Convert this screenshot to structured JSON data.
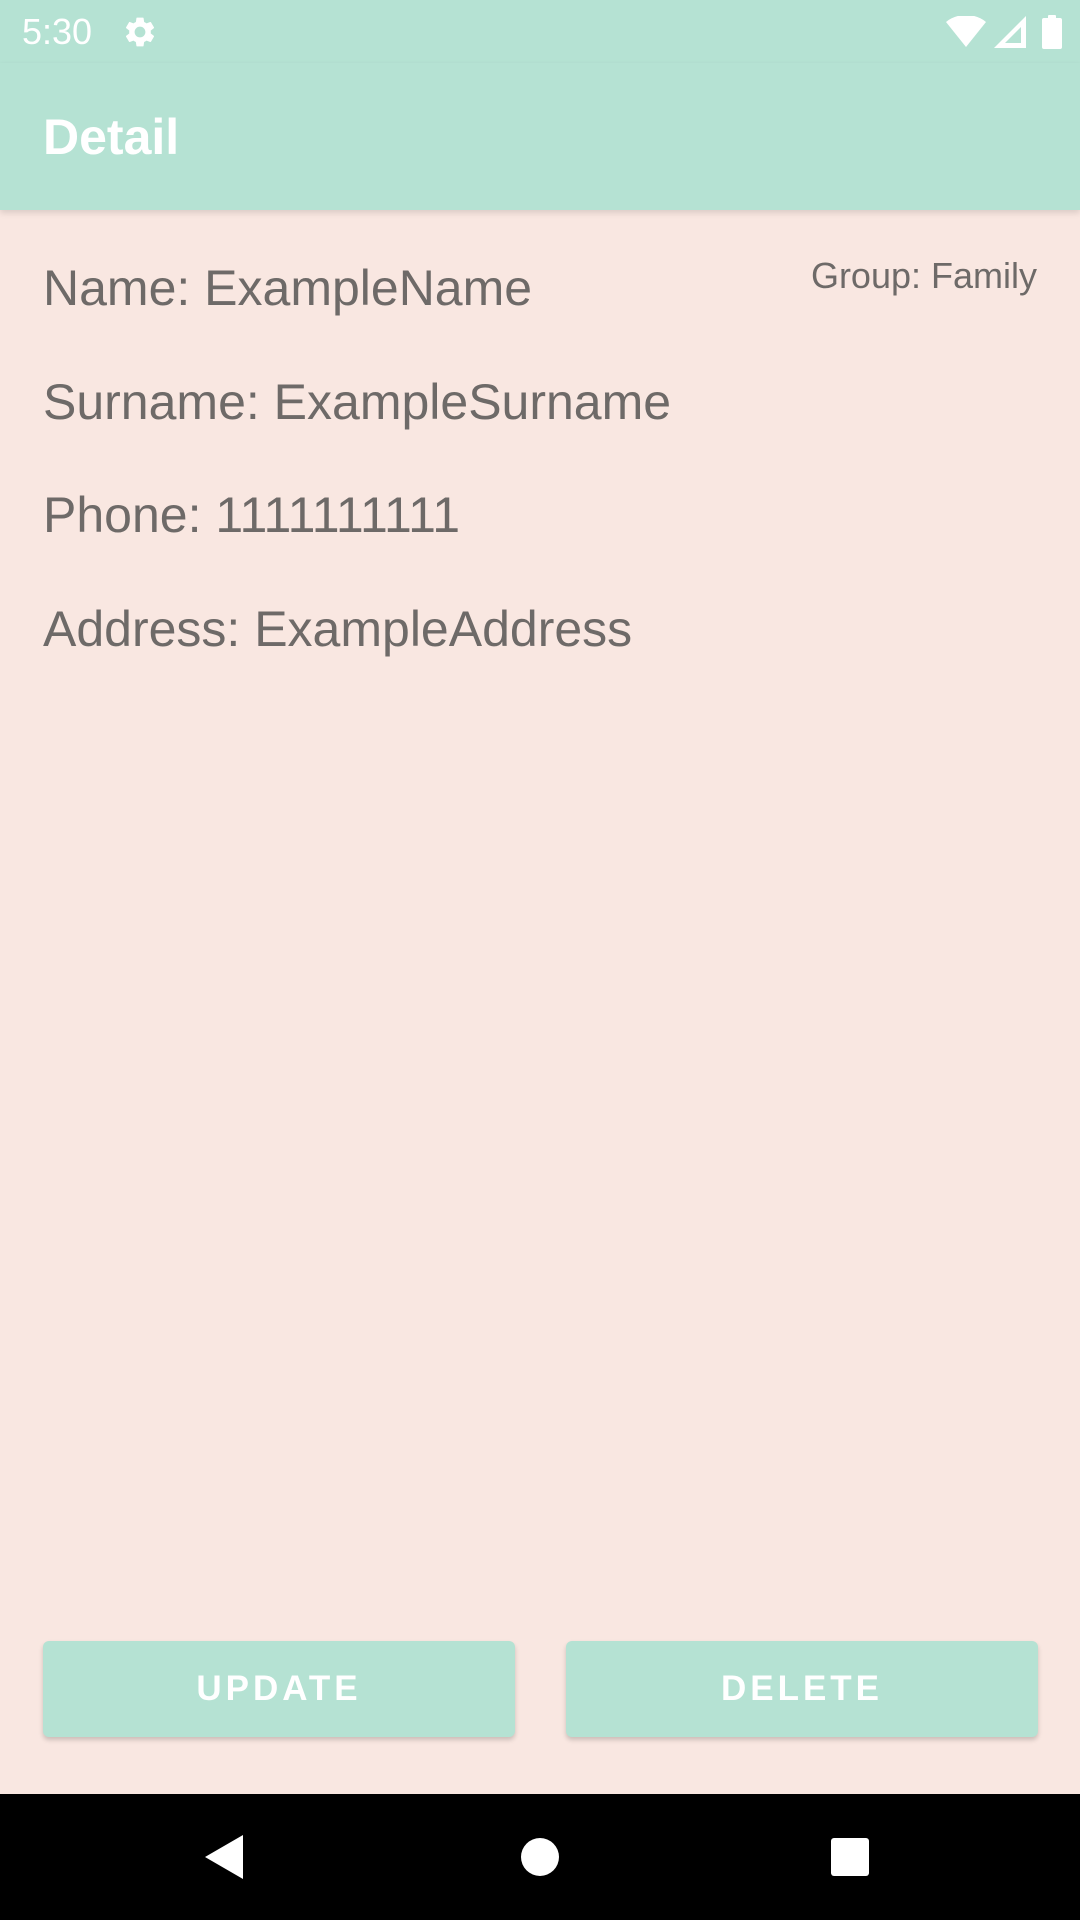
{
  "status_bar": {
    "time": "5:30",
    "icons": [
      "gear-icon",
      "wifi-icon",
      "cell-signal-icon",
      "battery-icon"
    ]
  },
  "app_bar": {
    "title": "Detail"
  },
  "detail": {
    "name": "Name: ExampleName",
    "surname": "Surname: ExampleSurname",
    "phone": "Phone: 1111111111",
    "address": "Address: ExampleAddress",
    "group": "Group: Family"
  },
  "actions": {
    "update_label": "UPDATE",
    "delete_label": "DELETE"
  },
  "nav_bar": {
    "icons": [
      "back-icon",
      "home-icon",
      "recents-icon"
    ]
  },
  "colors": {
    "accent": "#b5e2d3",
    "background": "#f9e7e1",
    "text": "#6e6a68"
  }
}
